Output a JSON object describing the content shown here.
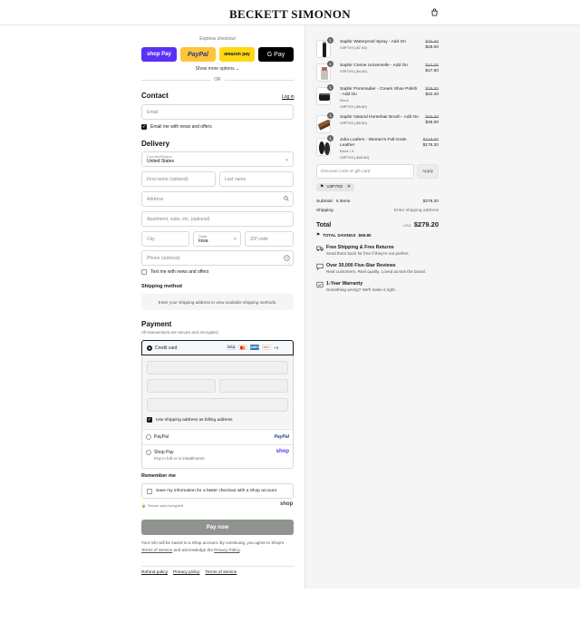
{
  "header": {
    "brand": "BECKETT SIMONON",
    "cart_icon": "shopping-bag-icon"
  },
  "express": {
    "title": "Express checkout",
    "buttons": [
      "shop Pay",
      "PayPal",
      "amazon pay",
      "G Pay"
    ],
    "show_more": "Show more options",
    "or": "OR"
  },
  "contact": {
    "title": "Contact",
    "login": "Log in",
    "email_placeholder": "Email",
    "news_label": "Email me with news and offers",
    "news_checked": true
  },
  "delivery": {
    "title": "Delivery",
    "country_label": "Country/Region",
    "country_value": "United States",
    "first_name": "First name (optional)",
    "last_name": "Last name",
    "address": "Address",
    "apartment": "Apartment, suite, etc. (optional)",
    "city": "City",
    "state_label": "State",
    "state_value": "Iowa",
    "zip": "ZIP code",
    "phone": "Phone (optional)",
    "text_label": "Text me with news and offers"
  },
  "shipping": {
    "title": "Shipping method",
    "message": "Enter your shipping address to view available shipping methods."
  },
  "payment": {
    "title": "Payment",
    "subtitle": "All transactions are secure and encrypted.",
    "credit_card": "Credit card",
    "card_brands": [
      "VISA",
      "MC",
      "AMEX",
      "DISC"
    ],
    "more_cards": "+4",
    "billing_label": "Use shipping address as billing address",
    "paypal": "PayPal",
    "paypal_logo": "PayPal",
    "shop_pay": "Shop Pay",
    "shop_pay_sub": "Pay in full or in installments",
    "shop_logo": "shop"
  },
  "remember": {
    "title": "Remember me",
    "label": "Save my information for a faster checkout with a Shop account",
    "secure": "Secure and encrypted",
    "shop_logo": "shop"
  },
  "paynow": "Pay now",
  "legal": {
    "text1": "Your info will be saved to a Shop account. By continuing, you agree to Shop's",
    "terms": "Terms of Service",
    "text2": "and acknowledge the",
    "privacy": "Privacy Policy",
    "end": "."
  },
  "footer": [
    "Refund policy",
    "Privacy policy",
    "Terms of service"
  ],
  "cart": {
    "items": [
      {
        "qty": "1",
        "name": "Saphir Waterproof Spray - Add On",
        "variant": "",
        "tag": "V3P7X9 (-$7.00)",
        "orig": "$35.00",
        "price": "$28.00"
      },
      {
        "qty": "1",
        "name": "Saphir Creme Universelle - Add On",
        "variant": "",
        "tag": "V3P7X9 (-$4.40)",
        "orig": "$22.00",
        "price": "$17.60"
      },
      {
        "qty": "1",
        "name": "Saphir Pommadier - Cream Shoe Polish - Add On",
        "variant": "Black",
        "tag": "V3P7X9 (-$5.60)",
        "orig": "$28.00",
        "price": "$22.40"
      },
      {
        "qty": "1",
        "name": "Saphir Natural Horsehair Brush - Add On",
        "variant": "",
        "tag": "V3P7X9 (-$9.00)",
        "orig": "$45.00",
        "price": "$36.00"
      },
      {
        "qty": "1",
        "name": "Julia Loafers - Women's Full-Grain Leather",
        "variant": "Black / 6",
        "tag": "V3P7X9 (-$43.80)",
        "orig": "$219.00",
        "price": "$175.20"
      }
    ],
    "discount_placeholder": "Discount code or gift card",
    "apply": "Apply",
    "code": "V3P7X9",
    "subtotal_label": "Subtotal · 5 items",
    "subtotal": "$279.20",
    "shipping_label": "Shipping",
    "shipping_value": "Enter shipping address",
    "total_label": "Total",
    "currency": "USD",
    "total": "$279.20",
    "savings_label": "TOTAL SAVINGS",
    "savings": "$69.80"
  },
  "perks": [
    {
      "icon": "truck-icon",
      "title": "Free Shipping & Free Returns",
      "desc": "Send them back for free if they're not perfect."
    },
    {
      "icon": "chat-icon",
      "title": "Over 30,000 Five-Star Reviews",
      "desc": "Real customers. Real quality. Loved across the board."
    },
    {
      "icon": "shield-icon",
      "title": "1-Year Warranty",
      "desc": "Something wrong? We'll make it right."
    }
  ]
}
